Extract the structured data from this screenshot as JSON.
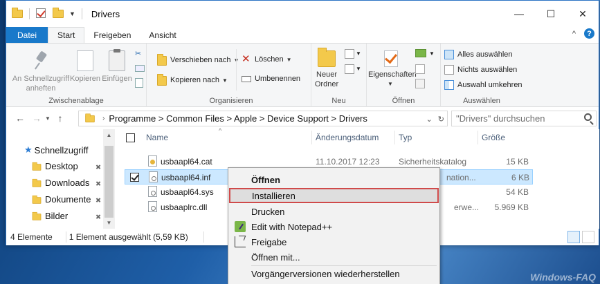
{
  "window": {
    "title": "Drivers",
    "controls": {
      "minimize": "—",
      "maximize": "☐",
      "close": "✕"
    }
  },
  "tabs": {
    "file": "Datei",
    "start": "Start",
    "share": "Freigeben",
    "view": "Ansicht"
  },
  "ribbon": {
    "clipboard": {
      "label": "Zwischenablage",
      "pin_line1": "An Schnellzugriff",
      "pin_line2": "anheften",
      "copy": "Kopieren",
      "paste": "Einfügen"
    },
    "organize": {
      "label": "Organisieren",
      "move_to": "Verschieben nach",
      "copy_to": "Kopieren nach",
      "delete": "Löschen",
      "rename": "Umbenennen"
    },
    "new": {
      "label": "Neu",
      "new_folder_line1": "Neuer",
      "new_folder_line2": "Ordner"
    },
    "open": {
      "label": "Öffnen",
      "properties": "Eigenschaften"
    },
    "select": {
      "label": "Auswählen",
      "select_all": "Alles auswählen",
      "select_none": "Nichts auswählen",
      "invert": "Auswahl umkehren"
    }
  },
  "address": {
    "path": "Programme  >  Common Files  >  Apple  >  Device Support  >  Drivers",
    "search_placeholder": "\"Drivers\" durchsuchen"
  },
  "navpane": {
    "items": [
      {
        "label": "Schnellzugriff"
      },
      {
        "label": "Desktop"
      },
      {
        "label": "Downloads"
      },
      {
        "label": "Dokumente"
      },
      {
        "label": "Bilder"
      }
    ]
  },
  "filelist": {
    "headers": {
      "name": "Name",
      "date": "Änderungsdatum",
      "type": "Typ",
      "size": "Größe"
    },
    "rows": [
      {
        "name": "usbaapl64.cat",
        "date": "11.10.2017 12:23",
        "type": "Sicherheitskatalog",
        "size": "15 KB"
      },
      {
        "name": "usbaapl64.inf",
        "date": "",
        "type": "nation...",
        "size": "6 KB"
      },
      {
        "name": "usbaapl64.sys",
        "date": "",
        "type": "",
        "size": "54 KB"
      },
      {
        "name": "usbaaplrc.dll",
        "date": "",
        "type": "erwe...",
        "size": "5.969 KB"
      }
    ]
  },
  "status": {
    "count": "4 Elemente",
    "selection": "1 Element ausgewählt (5,59 KB)"
  },
  "context_menu": {
    "items": [
      {
        "label": "Öffnen"
      },
      {
        "label": "Installieren"
      },
      {
        "label": "Drucken"
      },
      {
        "label": "Edit with Notepad++"
      },
      {
        "label": "Freigabe"
      },
      {
        "label": "Öffnen mit..."
      },
      {
        "label": "Vorgängerversionen wiederherstellen"
      }
    ]
  },
  "watermark": "Windows-FAQ",
  "colors": {
    "accent": "#1979ca",
    "selection": "#cce8ff",
    "highlight_border": "#d04a4a"
  }
}
